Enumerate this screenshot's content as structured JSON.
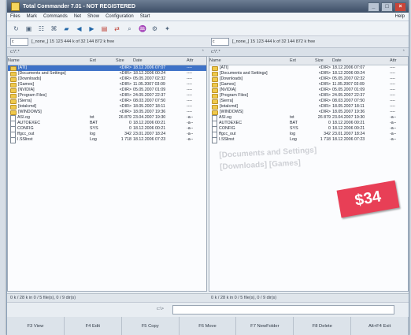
{
  "app": {
    "title": "Total Commander 7.01 - NOT REGISTERED",
    "menu": [
      "Files",
      "Mark",
      "Commands",
      "Net",
      "Show",
      "Configuration",
      "Start"
    ],
    "menu_right": "Help",
    "toolbar_icons": [
      "refresh-icon",
      "view-icon",
      "tree-icon",
      "compare-icon",
      "pack-icon",
      "back-icon",
      "forward-icon",
      "copy-icon",
      "move-icon",
      "search-icon",
      "network-icon",
      "settings-icon",
      "star-icon"
    ],
    "drive_left": "c",
    "drive_right": "c",
    "left_info": "[_none_] 15 123 444 k of 32 144 872 k free",
    "right_info": "[_none_] 15 123 444 k of 32 144 872 k free",
    "left_path": "c:\\*.*",
    "right_path": "c:\\*.*",
    "headers": {
      "name": "Name",
      "ext": "Ext",
      "size": "Size",
      "date": "Date",
      "attr": "Attr"
    },
    "files": [
      {
        "name": "[ATI]",
        "ext": "",
        "size": "<DIR>",
        "date": "18.12.2006 07:07",
        "attr": "----",
        "type": "folder"
      },
      {
        "name": "[Documents and Settings]",
        "ext": "",
        "size": "<DIR>",
        "date": "18.12.2006 00:24",
        "attr": "----",
        "type": "folder"
      },
      {
        "name": "[Downloads]",
        "ext": "",
        "size": "<DIR>",
        "date": "05.05.2007 02:32",
        "attr": "----",
        "type": "folder"
      },
      {
        "name": "[Games]",
        "ext": "",
        "size": "<DIR>",
        "date": "11.05.2007 03:09",
        "attr": "----",
        "type": "folder"
      },
      {
        "name": "[NVIDIA]",
        "ext": "",
        "size": "<DIR>",
        "date": "05.05.2007 01:09",
        "attr": "----",
        "type": "folder"
      },
      {
        "name": "[Program Files]",
        "ext": "",
        "size": "<DIR>",
        "date": "24.05.2007 22:37",
        "attr": "----",
        "type": "folder"
      },
      {
        "name": "[Sierra]",
        "ext": "",
        "size": "<DIR>",
        "date": "08.03.2007 07:50",
        "attr": "----",
        "type": "folder"
      },
      {
        "name": "[totalcmd]",
        "ext": "",
        "size": "<DIR>",
        "date": "18.05.2007 18:11",
        "attr": "----",
        "type": "folder"
      },
      {
        "name": "[WINDOWS]",
        "ext": "",
        "size": "<DIR>",
        "date": "18.05.2007 19:36",
        "attr": "----",
        "type": "folder"
      },
      {
        "name": "ASI.og",
        "ext": "txt",
        "size": "26 879",
        "date": "23.04.2007 19:30",
        "attr": "-a--",
        "type": "file"
      },
      {
        "name": "AUTOEXEC",
        "ext": "BAT",
        "size": "0",
        "date": "18.12.2006 00:21",
        "attr": "-a--",
        "type": "file"
      },
      {
        "name": "CONFIG",
        "ext": "SYS",
        "size": "0",
        "date": "18.12.2006 00:21",
        "attr": "-a--",
        "type": "file"
      },
      {
        "name": "ffgcc_out",
        "ext": "log",
        "size": "342",
        "date": "23.01.2007 18:24",
        "attr": "-a--",
        "type": "file"
      },
      {
        "name": "I.SSlinst",
        "ext": "Log",
        "size": "1 718",
        "date": "18.12.2006 07:23",
        "attr": "-a--",
        "type": "file"
      }
    ],
    "left_status": "0 k / 28 k in 0 / 5 file(s), 0 / 9 dir(s)",
    "right_status": "0 k / 28 k in 0 / 5 file(s), 0 / 9 dir(s)",
    "cmd_label": "c:\\>",
    "fkeys": [
      "F3 View",
      "F4 Edit",
      "F5 Copy",
      "F6 Move",
      "F7 NewFolder",
      "F8 Delete",
      "Alt+F4 Exit"
    ],
    "stamp": "$34",
    "ghost_text": "[Documents and Settings] [Downloads] [Games]"
  }
}
